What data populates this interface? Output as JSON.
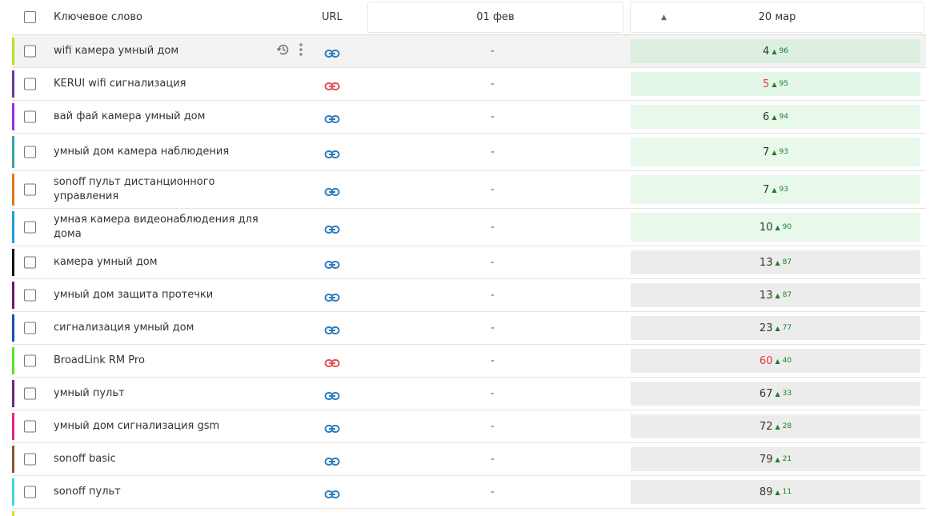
{
  "header": {
    "keyword_label": "Ключевое слово",
    "url_label": "URL",
    "date1_label": "01 фев",
    "sort_indicator": "▲",
    "date2_label": "20 мар"
  },
  "rows": [
    {
      "keyword": "wifi камера умный дом",
      "color": "#b5e21e",
      "link": "#2b7fc2",
      "prev": "-",
      "pos": "4",
      "pos_red": false,
      "delta": "96",
      "bg": "#dcefe0",
      "hover": true
    },
    {
      "keyword": "KERUI wifi сигнализация",
      "color": "#6a3d9a",
      "link": "#e05252",
      "prev": "-",
      "pos": "5",
      "pos_red": true,
      "delta": "95",
      "bg": "#e3f6e7"
    },
    {
      "keyword": "вай фай камера умный дом",
      "color": "#9b30e0",
      "link": "#2b7fc2",
      "prev": "-",
      "pos": "6",
      "pos_red": false,
      "delta": "94",
      "bg": "#e8f8ea"
    },
    {
      "keyword": "умный дом камера наблюдения",
      "color": "#3aa4a4",
      "link": "#2b7fc2",
      "prev": "-",
      "pos": "7",
      "pos_red": false,
      "delta": "93",
      "bg": "#e8f8ea",
      "tall": true
    },
    {
      "keyword": "sonoff пульт дистанционного управления",
      "color": "#e07a1a",
      "link": "#2b7fc2",
      "prev": "-",
      "pos": "7",
      "pos_red": false,
      "delta": "93",
      "bg": "#e8f8ea",
      "tall": true
    },
    {
      "keyword": "умная камера видеонаблюдения для дома",
      "color": "#1ea0d8",
      "link": "#2b7fc2",
      "prev": "-",
      "pos": "10",
      "pos_red": false,
      "delta": "90",
      "bg": "#e8f8ea",
      "tall": true
    },
    {
      "keyword": "камера умный дом",
      "color": "#111111",
      "link": "#2b7fc2",
      "prev": "-",
      "pos": "13",
      "pos_red": false,
      "delta": "87",
      "bg": "#ececec"
    },
    {
      "keyword": "умный дом защита протечки",
      "color": "#6a1a6a",
      "link": "#2b7fc2",
      "prev": "-",
      "pos": "13",
      "pos_red": false,
      "delta": "87",
      "bg": "#ececec"
    },
    {
      "keyword": "сигнализация умный дом",
      "color": "#1a4fb0",
      "link": "#2b7fc2",
      "prev": "-",
      "pos": "23",
      "pos_red": false,
      "delta": "77",
      "bg": "#ececec"
    },
    {
      "keyword": "BroadLink RM Pro",
      "color": "#5be02a",
      "link": "#e05252",
      "prev": "-",
      "pos": "60",
      "pos_red": true,
      "delta": "40",
      "bg": "#ececec"
    },
    {
      "keyword": "умный пульт",
      "color": "#6a2a7a",
      "link": "#2b7fc2",
      "prev": "-",
      "pos": "67",
      "pos_red": false,
      "delta": "33",
      "bg": "#ececec"
    },
    {
      "keyword": "умный дом сигнализация gsm",
      "color": "#e0288a",
      "link": "#2b7fc2",
      "prev": "-",
      "pos": "72",
      "pos_red": false,
      "delta": "28",
      "bg": "#ececec"
    },
    {
      "keyword": "sonoff basic",
      "color": "#8a5a2a",
      "link": "#2b7fc2",
      "prev": "-",
      "pos": "79",
      "pos_red": false,
      "delta": "21",
      "bg": "#ececec"
    },
    {
      "keyword": "sonoff пульт",
      "color": "#3ad8e0",
      "link": "#2b7fc2",
      "prev": "-",
      "pos": "89",
      "pos_red": false,
      "delta": "11",
      "bg": "#ececec"
    }
  ]
}
